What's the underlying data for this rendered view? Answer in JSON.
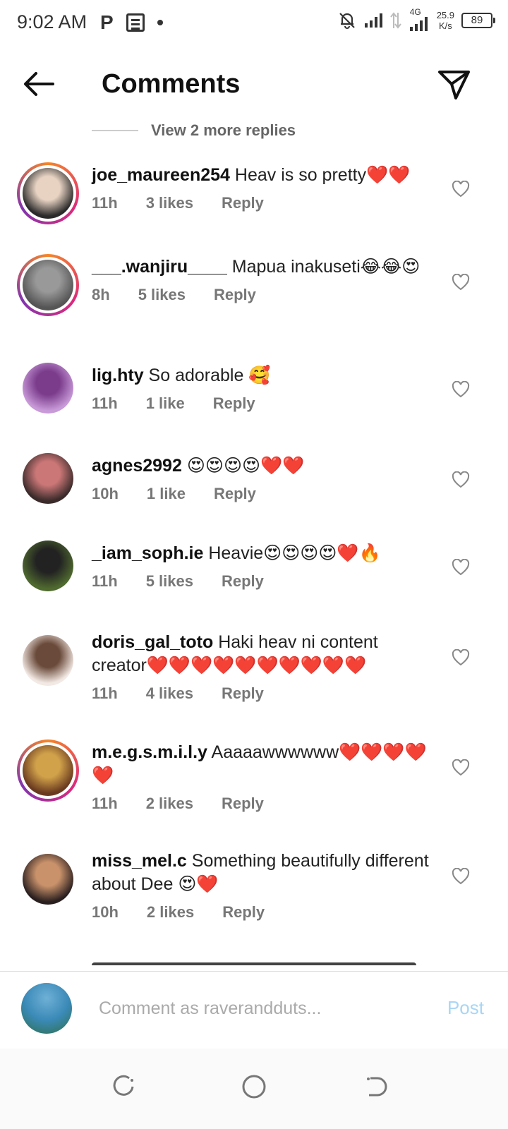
{
  "status_bar": {
    "time": "9:02 AM",
    "p_icon": "P",
    "network": "4G",
    "speed_value": "25.9",
    "speed_unit": "K/s",
    "battery": "89"
  },
  "header": {
    "title": "Comments",
    "back_icon": "arrow-left-icon",
    "share_icon": "paper-plane-icon"
  },
  "view_replies": "View 2 more replies",
  "comments": [
    {
      "user": "joe_maureen254",
      "text": " Heav is so pretty❤️❤️",
      "time": "11h",
      "likes": "3 likes",
      "reply": "Reply",
      "story_ring": true
    },
    {
      "user": "___.wanjiru____",
      "text": " Mapua inakuseti😂😂😍",
      "time": "8h",
      "likes": "5 likes",
      "reply": "Reply",
      "story_ring": true
    },
    {
      "user": "lig.hty",
      "text": " So adorable 🥰",
      "time": "11h",
      "likes": "1 like",
      "reply": "Reply",
      "story_ring": false
    },
    {
      "user": "agnes2992",
      "text": " 😍😍😍😍❤️❤️",
      "time": "10h",
      "likes": "1 like",
      "reply": "Reply",
      "story_ring": false
    },
    {
      "user": "_iam_soph.ie",
      "text": " Heavie😍😍😍😍❤️🔥",
      "time": "11h",
      "likes": "5 likes",
      "reply": "Reply",
      "story_ring": false
    },
    {
      "user": "doris_gal_toto",
      "text": " Haki heav ni content creator❤️❤️❤️❤️❤️❤️❤️❤️❤️❤️",
      "time": "11h",
      "likes": "4 likes",
      "reply": "Reply",
      "story_ring": false
    },
    {
      "user": "m.e.g.s.m.i.l.y",
      "text": " Aaaaawwwwww❤️❤️❤️❤️❤️",
      "time": "11h",
      "likes": "2 likes",
      "reply": "Reply",
      "story_ring": true
    },
    {
      "user": "miss_mel.c",
      "text": " Something beautifully different about Dee 😍❤️",
      "time": "10h",
      "likes": "2 likes",
      "reply": "Reply",
      "story_ring": false
    }
  ],
  "comment_input": {
    "placeholder": "Comment as raverandduts...",
    "post_label": "Post"
  },
  "colors": {
    "story_ring": "#dd2a7b",
    "post_disabled": "#a8d6f5",
    "meta_text": "#777777"
  }
}
